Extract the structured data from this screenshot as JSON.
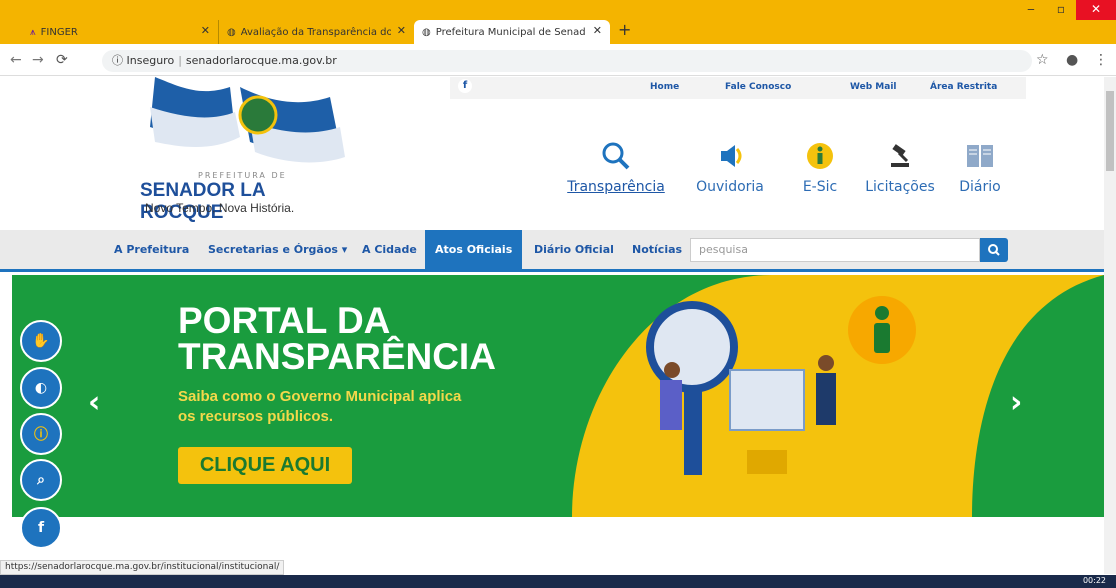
{
  "browser": {
    "tabs": [
      {
        "title": "FINGER"
      },
      {
        "title": "Avaliação da Transparência dos Á"
      },
      {
        "title": "Prefeitura Municipal de Senador"
      }
    ],
    "new_tab": "+",
    "security_label": "Inseguro",
    "url": "senadorlarocque.ma.gov.br",
    "status_url": "https://senadorlarocque.ma.gov.br/institucional/institucional/",
    "clock": "00:22"
  },
  "site": {
    "top_links": [
      "Home",
      "Fale Conosco",
      "Web Mail",
      "Área Restrita"
    ],
    "facebook_mini": "f",
    "logo": {
      "prefix": "PREFEITURA DE",
      "name": "SENADOR LA ROCQUE",
      "slogan": "Novo Tempo, Nova História."
    },
    "quick_links": [
      {
        "label": "Transparência",
        "icon": "search-icon"
      },
      {
        "label": "Ouvidoria",
        "icon": "speaker-icon"
      },
      {
        "label": "E-Sic",
        "icon": "info-icon"
      },
      {
        "label": "Licitações",
        "icon": "gavel-icon"
      },
      {
        "label": "Diário",
        "icon": "book-icon"
      }
    ],
    "nav": {
      "items": [
        "A Prefeitura",
        "Secretarias e Órgãos ▾",
        "A Cidade",
        "Atos Oficiais",
        "Diário Oficial",
        "Notícias"
      ],
      "search_placeholder": "pesquisa"
    },
    "banner": {
      "title_line1": "PORTAL DA",
      "title_line2": "TRANSPARÊNCIA",
      "subtitle_line1": "Saiba como o Governo Municipal aplica",
      "subtitle_line2": "os recursos públicos.",
      "cta": "CLIQUE AQUI"
    },
    "accessibility": [
      "sign-language-icon",
      "contrast-icon",
      "info-icon",
      "search-icon",
      "facebook-icon"
    ],
    "colors": {
      "accent": "#1e73be",
      "banner": "#1a9c3e",
      "highlight": "#f4c20d"
    }
  }
}
